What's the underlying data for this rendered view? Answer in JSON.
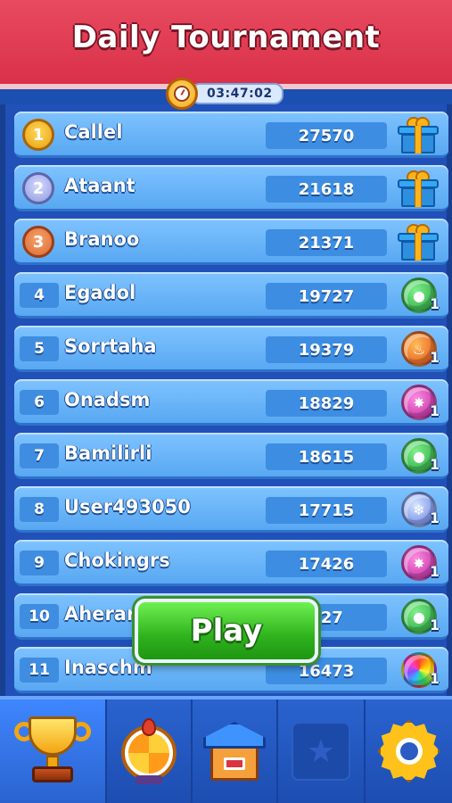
{
  "header": {
    "title": "Daily Tournament",
    "timer": "03:47:02"
  },
  "rows": [
    {
      "rank": "1",
      "name": "Callel",
      "score": "27570",
      "reward": "gift",
      "medal": "gold"
    },
    {
      "rank": "2",
      "name": "Ataant",
      "score": "21618",
      "reward": "gift",
      "medal": "silver"
    },
    {
      "rank": "3",
      "name": "Branoo",
      "score": "21371",
      "reward": "gift",
      "medal": "bronze"
    },
    {
      "rank": "4",
      "name": "Egadol",
      "score": "19727",
      "reward": "green-orb",
      "count": "1"
    },
    {
      "rank": "5",
      "name": "Sorrtaha",
      "score": "19379",
      "reward": "fire-orb",
      "count": "1"
    },
    {
      "rank": "6",
      "name": "Onadsm",
      "score": "18829",
      "reward": "pink-orb",
      "count": "1"
    },
    {
      "rank": "7",
      "name": "Bamilirli",
      "score": "18615",
      "reward": "green-orb",
      "count": "1"
    },
    {
      "rank": "8",
      "name": "User493050",
      "score": "17715",
      "reward": "ice-orb",
      "count": "1"
    },
    {
      "rank": "9",
      "name": "Chokingrs",
      "score": "17426",
      "reward": "pink-orb",
      "count": "1"
    },
    {
      "rank": "10",
      "name": "Aherar",
      "score": "927",
      "reward": "green-orb",
      "count": "1"
    },
    {
      "rank": "11",
      "name": "Inaschm",
      "score": "16473",
      "reward": "rainbow-orb",
      "count": "1"
    }
  ],
  "play_button": {
    "label": "Play"
  },
  "navbar": {
    "items": [
      "trophy-icon",
      "prize-wheel-icon",
      "home-icon",
      "locked-star-icon",
      "settings-gear-icon"
    ],
    "active": "trophy-icon"
  },
  "colors": {
    "header": "#d93149",
    "board": "#2150b8",
    "row": "#6fb8fb",
    "play": "#2fb21d"
  }
}
